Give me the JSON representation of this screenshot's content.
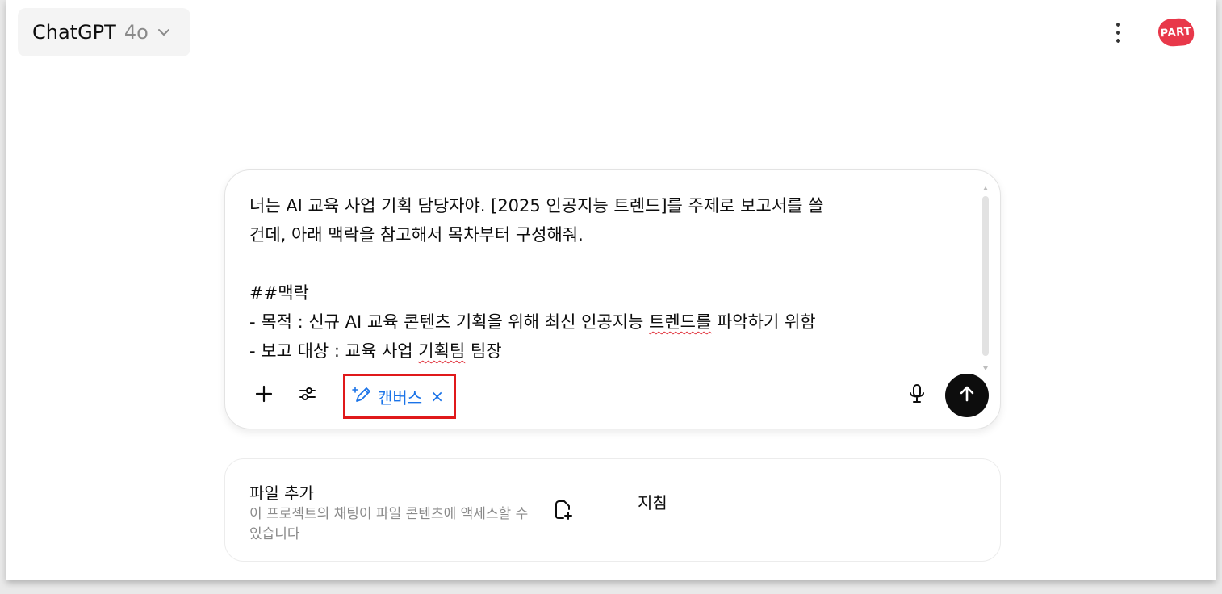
{
  "header": {
    "model_name": "ChatGPT",
    "model_version": "4o",
    "avatar_text": "PART"
  },
  "composer": {
    "lines": [
      "너는 AI 교육 사업 기획 담당자야. [2025 인공지능 트렌드]를 주제로 보고서를 쓸",
      "건데, 아래 맥락을 참고해서 목차부터 구성해줘.",
      "",
      "##맥락"
    ],
    "line5_before": "- 목적 : 신규 AI 교육 콘텐츠 기획을 위해 최신 인공지능 ",
    "line5_flagged": "트렌드를",
    "line5_after": " 파악하기 위함",
    "line6_before": "- 보고 대상 : 교육 사업 ",
    "line6_flagged": "기획팀",
    "line6_after": " 팀장",
    "canvas_chip_label": "캔버스",
    "canvas_chip_close": "×",
    "accent_color": "#1a73e8",
    "highlight_color": "#e0191b"
  },
  "cards": {
    "files": {
      "title": "파일 추가",
      "description": "이 프로젝트의 채팅이 파일 콘텐츠에 액세스할 수 있습니다"
    },
    "instructions": {
      "title": "지침"
    }
  },
  "icons": [
    "chevron-down-icon",
    "more-vertical-icon",
    "plus-icon",
    "sliders-icon",
    "canvas-pen-icon",
    "microphone-icon",
    "arrow-up-icon",
    "file-add-icon"
  ]
}
